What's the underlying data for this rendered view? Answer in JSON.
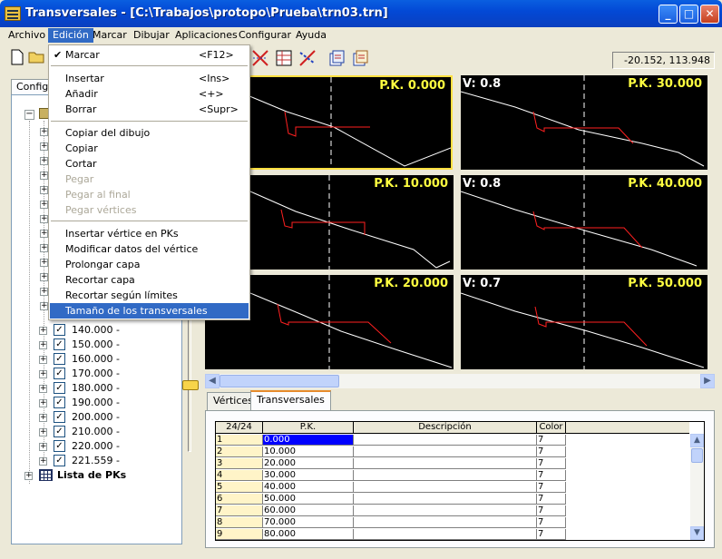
{
  "window": {
    "title": "Transversales - [C:\\Trabajos\\protopo\\Prueba\\trn03.trn]",
    "min": "_",
    "max": "□",
    "close": "✕"
  },
  "menubar": [
    "Archivo",
    "Edición",
    "Marcar",
    "Dibujar",
    "Aplicaciones",
    "Configurar",
    "Ayuda"
  ],
  "coords": "-20.152, 113.948",
  "left_tab": "Config.",
  "tree": {
    "rows": [
      "140.000 -",
      "150.000 -",
      "160.000 -",
      "170.000 -",
      "180.000 -",
      "190.000 -",
      "200.000 -",
      "210.000 -",
      "220.000 -",
      "221.559 -"
    ],
    "pk_list": "Lista de PKs"
  },
  "edit_menu": {
    "marcar": {
      "label": "Marcar",
      "shortcut": "<F12>",
      "check": "✔"
    },
    "insertar": {
      "label": "Insertar",
      "shortcut": "<Ins>"
    },
    "anadir": {
      "label": "Añadir",
      "shortcut": "<+>"
    },
    "borrar": {
      "label": "Borrar",
      "shortcut": "<Supr>"
    },
    "copiar_dibujo": "Copiar del dibujo",
    "copiar": "Copiar",
    "cortar": "Cortar",
    "pegar": "Pegar",
    "pegar_final": "Pegar al final",
    "pegar_vertices": "Pegar vértices",
    "insertar_vertice": "Insertar vértice en PKs",
    "modificar_datos": "Modificar datos del vértice",
    "prolongar": "Prolongar capa",
    "recortar": "Recortar capa",
    "recortar_limites": "Recortar según límites",
    "tamano": "Tamaño de los transversales"
  },
  "panels": [
    {
      "pk": "P.K. 0.000",
      "v": ""
    },
    {
      "pk": "P.K. 30.000",
      "v": "V: 0.8"
    },
    {
      "pk": "P.K. 10.000",
      "v": ""
    },
    {
      "pk": "P.K. 40.000",
      "v": "V: 0.8"
    },
    {
      "pk": "P.K. 20.000",
      "v": ""
    },
    {
      "pk": "P.K. 50.000",
      "v": "V: 0.7"
    }
  ],
  "bottom_tabs": [
    "Vértices",
    "Transversales"
  ],
  "grid": {
    "corner": "24/24",
    "headers": [
      "P.K.",
      "Descripción",
      "Color"
    ],
    "rows": [
      [
        "1",
        "0.000",
        "",
        "7"
      ],
      [
        "2",
        "10.000",
        "",
        "7"
      ],
      [
        "3",
        "20.000",
        "",
        "7"
      ],
      [
        "4",
        "30.000",
        "",
        "7"
      ],
      [
        "5",
        "40.000",
        "",
        "7"
      ],
      [
        "6",
        "50.000",
        "",
        "7"
      ],
      [
        "7",
        "60.000",
        "",
        "7"
      ],
      [
        "8",
        "70.000",
        "",
        "7"
      ],
      [
        "9",
        "80.000",
        "",
        "7"
      ]
    ]
  },
  "colors": {
    "terrain": "#ffffff",
    "road": "#ff2020",
    "axis": "#ffffff",
    "label": "#ffff40"
  }
}
